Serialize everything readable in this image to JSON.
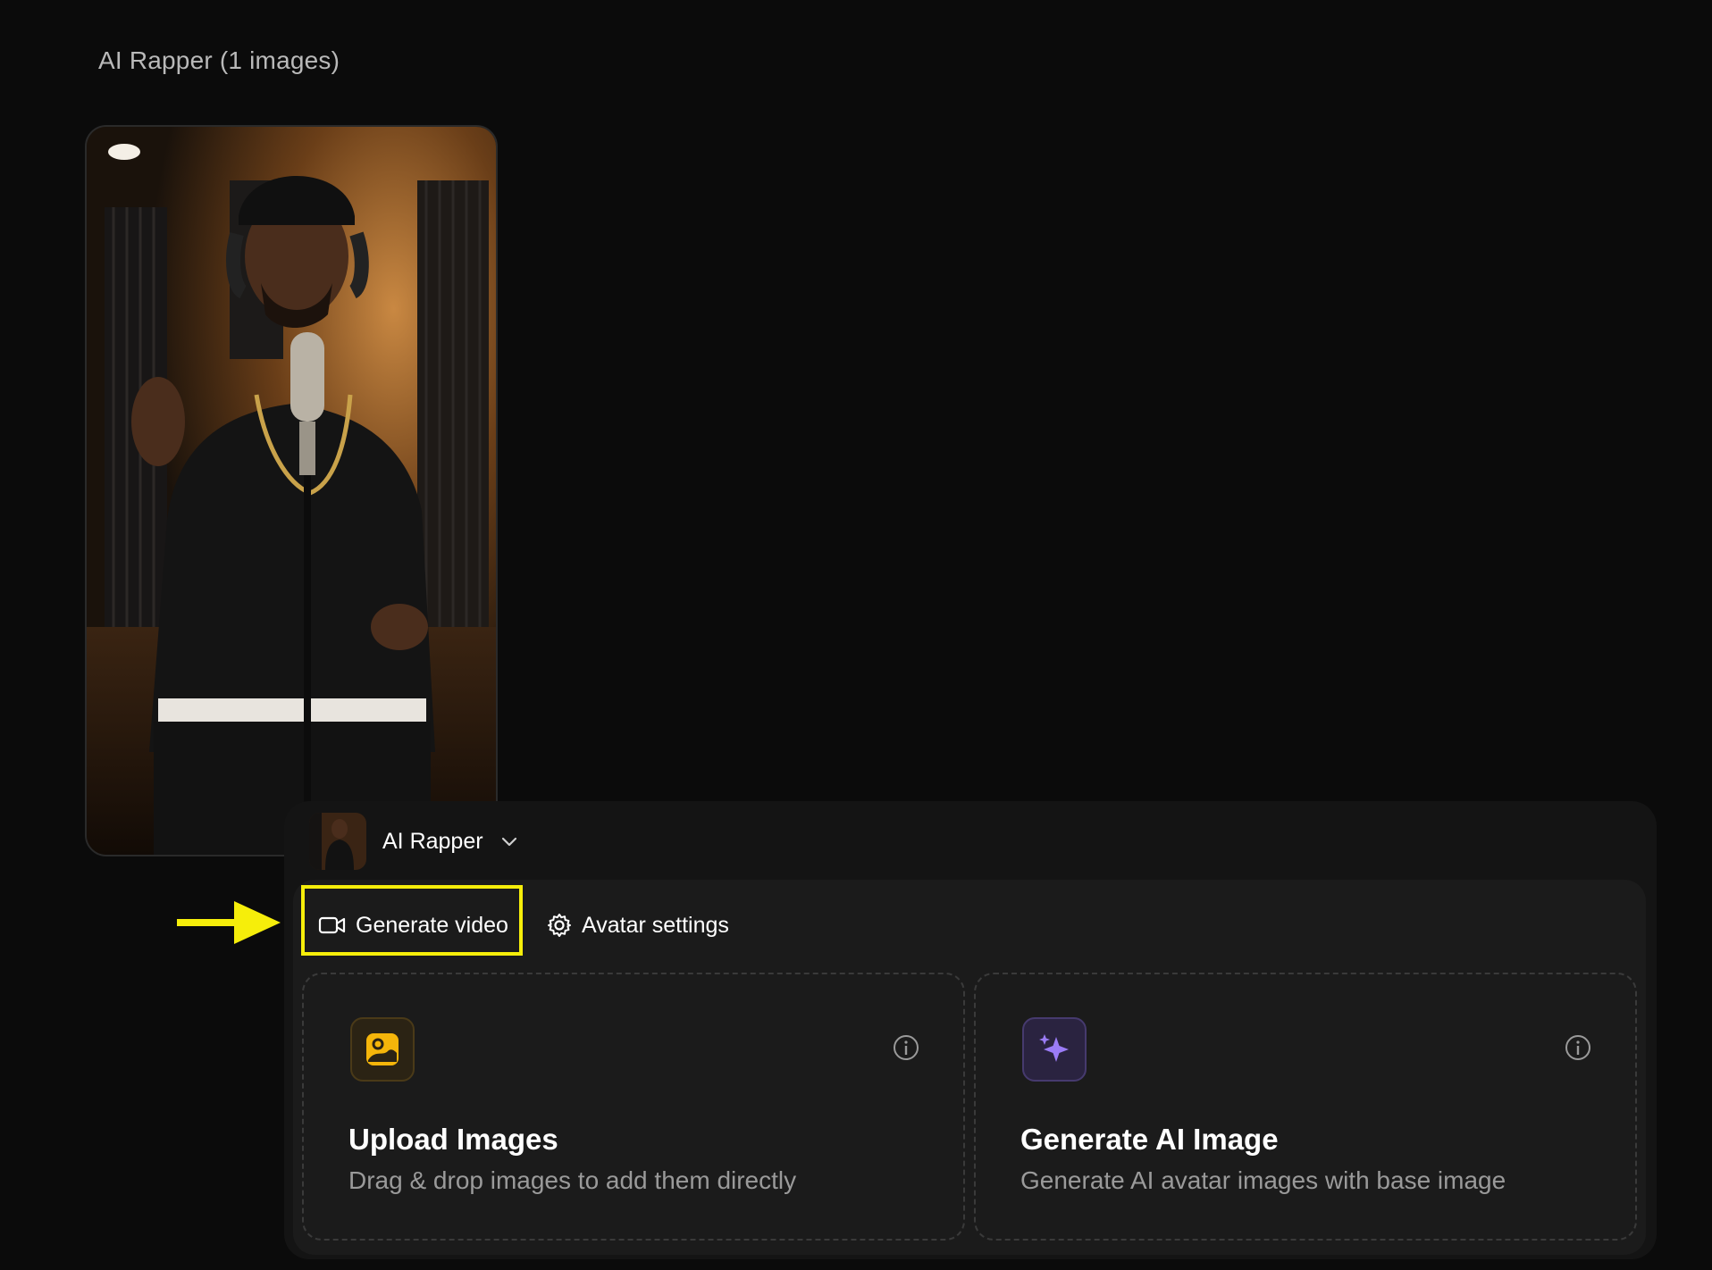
{
  "gallery": {
    "title": "AI Rapper (1 images)"
  },
  "avatar_selector": {
    "name": "AI Rapper",
    "icon": "chevron-down-icon"
  },
  "tabs": {
    "generate_video": "Generate video",
    "avatar_settings": "Avatar settings"
  },
  "cards": {
    "upload": {
      "title": "Upload Images",
      "description": "Drag & drop images to add them directly",
      "icon": "image-upload-icon",
      "accent": "#f5b50a"
    },
    "generate": {
      "title": "Generate AI Image",
      "description": "Generate AI avatar images with base image",
      "icon": "sparkles-icon",
      "accent": "#9b7cf7"
    }
  },
  "annotation": {
    "highlight_color": "#f6ee0a"
  }
}
